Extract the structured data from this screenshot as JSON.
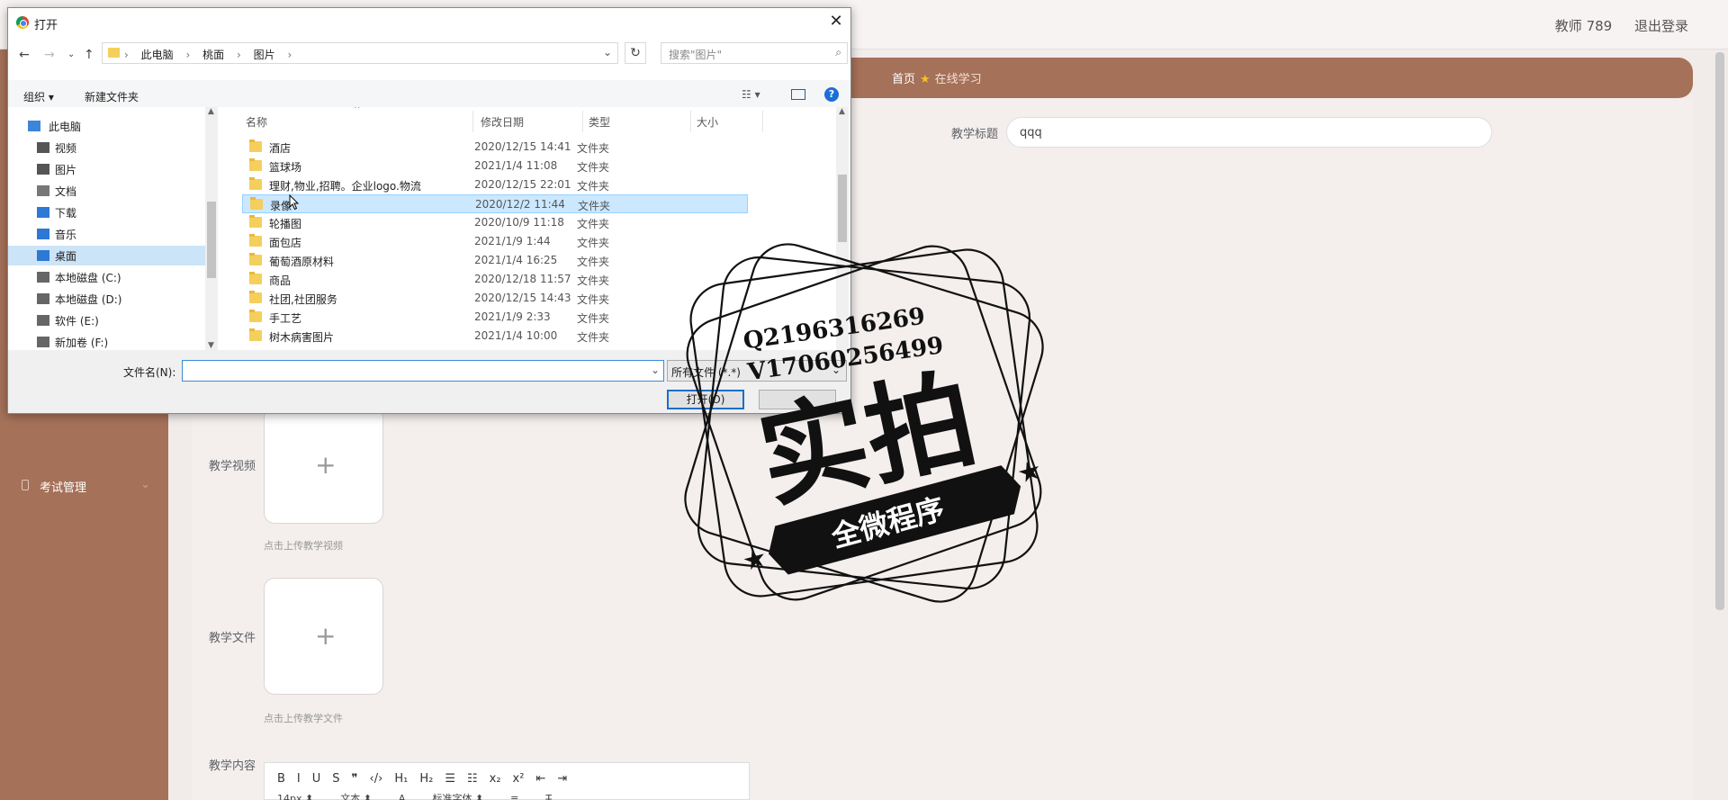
{
  "header": {
    "user": "教师 789",
    "logout": "退出登录"
  },
  "breadcrumb": {
    "home": "首页",
    "current": "在线学习"
  },
  "sidebar": {
    "items": [
      {
        "label": "考试管理"
      }
    ]
  },
  "form": {
    "title_label": "教学标题",
    "title_value": "qqq",
    "video_label": "教学视频",
    "video_hint": "点击上传教学视频",
    "file_label": "教学文件",
    "file_hint": "点击上传教学文件",
    "content_label": "教学内容"
  },
  "editor": {
    "toolbar": [
      "B",
      "I",
      "U",
      "S",
      "❞",
      "‹/›",
      "H₁",
      "H₂",
      "☰",
      "☷",
      "x₂",
      "x²",
      "⇤",
      "⇥"
    ],
    "toolbar2": [
      "14px ⬍",
      "文本 ⬍",
      "A",
      "标准字体 ⬍",
      "≡",
      "T̶"
    ]
  },
  "dialog": {
    "title": "打开",
    "address": [
      "此电脑",
      "桃面",
      "图片"
    ],
    "search_placeholder": "搜索\"图片\"",
    "organize": "组织 ▾",
    "new_folder": "新建文件夹",
    "tree": [
      {
        "label": "此电脑",
        "icon": "computer-icon",
        "color": "#3c86d8"
      },
      {
        "label": "视频",
        "icon": "video-icon",
        "color": "#555"
      },
      {
        "label": "图片",
        "icon": "picture-icon",
        "color": "#555"
      },
      {
        "label": "文档",
        "icon": "document-icon",
        "color": "#777"
      },
      {
        "label": "下载",
        "icon": "download-icon",
        "color": "#2e78d6"
      },
      {
        "label": "音乐",
        "icon": "music-icon",
        "color": "#2e78d6"
      },
      {
        "label": "桌面",
        "icon": "desktop-icon",
        "color": "#2e78d6",
        "selected": true
      },
      {
        "label": "本地磁盘 (C:)",
        "icon": "drive-icon",
        "color": "#666"
      },
      {
        "label": "本地磁盘 (D:)",
        "icon": "drive-icon",
        "color": "#666"
      },
      {
        "label": "软件 (E:)",
        "icon": "drive-icon",
        "color": "#666"
      },
      {
        "label": "新加卷 (F:)",
        "icon": "drive-icon",
        "color": "#666"
      }
    ],
    "columns": {
      "name": "名称",
      "date": "修改日期",
      "type": "类型",
      "size": "大小"
    },
    "files": [
      {
        "name": "酒店",
        "date": "2020/12/15 14:41",
        "type": "文件夹"
      },
      {
        "name": "篮球场",
        "date": "2021/1/4 11:08",
        "type": "文件夹"
      },
      {
        "name": "理财,物业,招聘。企业logo.物流",
        "date": "2020/12/15 22:01",
        "type": "文件夹"
      },
      {
        "name": "录像",
        "date": "2020/12/2 11:44",
        "type": "文件夹",
        "selected": true
      },
      {
        "name": "轮播图",
        "date": "2020/10/9 11:18",
        "type": "文件夹"
      },
      {
        "name": "面包店",
        "date": "2021/1/9 1:44",
        "type": "文件夹"
      },
      {
        "name": "葡萄酒原材料",
        "date": "2021/1/4 16:25",
        "type": "文件夹"
      },
      {
        "name": "商品",
        "date": "2020/12/18 11:57",
        "type": "文件夹"
      },
      {
        "name": "社团,社团服务",
        "date": "2020/12/15 14:43",
        "type": "文件夹"
      },
      {
        "name": "手工艺",
        "date": "2021/1/9 2:33",
        "type": "文件夹"
      },
      {
        "name": "树木病害图片",
        "date": "2021/1/4 10:00",
        "type": "文件夹"
      }
    ],
    "filename_label": "文件名(N):",
    "filename_value": "",
    "filetype": "所有文件 (*.*)",
    "open_button": "打开(O)"
  },
  "watermark": {
    "line1": "Q2196316269",
    "line2": "V17060256499",
    "big": "实拍",
    "ribbon": "全微程序"
  }
}
